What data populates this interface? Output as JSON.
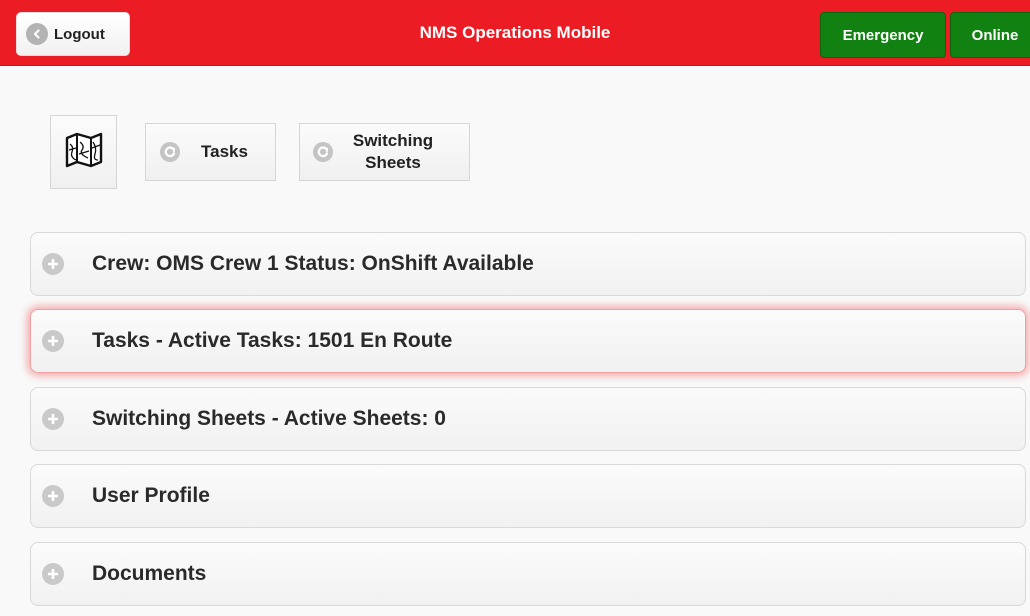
{
  "header": {
    "logout_label": "Logout",
    "title": "NMS Operations Mobile",
    "emergency_label": "Emergency",
    "online_label": "Online",
    "brand_color": "#ec1c24",
    "status_color": "#118111"
  },
  "toolbar": {
    "map_icon": "map-icon",
    "tasks_label": "Tasks",
    "switching_label_line1": "Switching",
    "switching_label_line2": "Sheets"
  },
  "panels": [
    {
      "label": "Crew: OMS Crew 1 Status: OnShift Available",
      "icon": "plus-icon"
    },
    {
      "label": "Tasks - Active Tasks: 1501 En Route",
      "icon": "plus-icon",
      "highlighted": true
    },
    {
      "label": "Switching Sheets - Active Sheets: 0",
      "icon": "plus-icon"
    },
    {
      "label": "User Profile",
      "icon": "plus-icon"
    },
    {
      "label": "Documents",
      "icon": "plus-icon"
    }
  ]
}
